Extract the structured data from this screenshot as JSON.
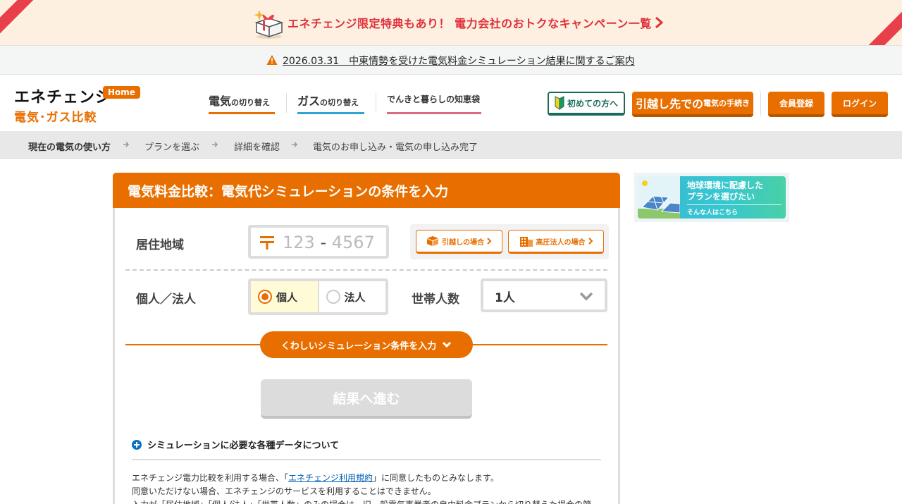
{
  "campaign": {
    "text": "エネチェンジ限定特典もあり！ 電力会社のおトクなキャンペーン一覧"
  },
  "notice": {
    "text": "2026.03.31　中東情勢を受けた電気料金シミュレーション結果に関するご案内"
  },
  "header": {
    "logo_main": "エネチェンジ",
    "logo_home": "Home",
    "logo_sub": "電気･ガス比較",
    "nav": {
      "electric_main": "電気",
      "electric_sub": "の切り替え",
      "gas_main": "ガス",
      "gas_sub": "の切り替え",
      "life": "でんきと暮らしの知恵袋"
    },
    "first_time": "初めての方へ",
    "moving_main": "引越し先での",
    "moving_sub": "電気の手続き",
    "register": "会員登録",
    "login": "ログイン"
  },
  "steps": [
    {
      "label": "現在の電気の使い方"
    },
    {
      "label": "プランを選ぶ"
    },
    {
      "label": "詳細を確認"
    },
    {
      "label": "電気のお申し込み・電気の申し込み完了"
    }
  ],
  "form": {
    "title": "電気料金比較：電気代シミュレーションの条件を入力",
    "region_label": "居住地域",
    "zip_placeholder_1": "123",
    "zip_dash": "-",
    "zip_placeholder_2": "4567",
    "moving_case": "引越しの場合",
    "high_voltage_case": "高圧法人の場合",
    "type_label": "個人／法人",
    "type_options": [
      "個人",
      "法人"
    ],
    "household_label": "世帯人数",
    "household_value": "1人",
    "detail_button": "くわしいシミュレーション条件を入力",
    "submit": "結果へ進む",
    "info_toggle": "シミュレーションに必要な各種データについて",
    "terms_1_pre": "エネチェンジ電力比較を利用する場合、「",
    "terms_1_link": "エネチェンジ利用規約",
    "terms_1_post": "」に同意したものとみなします。",
    "terms_2": "同意いただけない場合、エネチェンジのサービスを利用することはできません。",
    "terms_3": "入力が「居住地域」「個人/法人」「世帯人数」のみの場合は、旧一般電気事業者の自由料金プランから切り替えた場合の節"
  },
  "side_banner": {
    "line1": "地球環境に配慮した",
    "line2": "プランを選びたい",
    "line3": "そんな人はこちら"
  },
  "colors": {
    "accent": "#e86e00",
    "campaign_red": "#e0303a",
    "gas_blue": "#30a4d0",
    "life_pink": "#d86a84",
    "link_blue": "#0060b6"
  }
}
